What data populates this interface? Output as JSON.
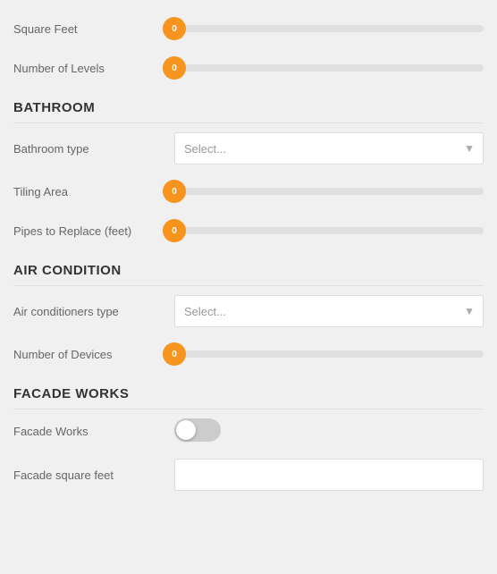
{
  "fields": {
    "square_feet": {
      "label": "Square Feet",
      "value": "0",
      "slider_pct": 0
    },
    "number_of_levels": {
      "label": "Number of Levels",
      "value": "0",
      "slider_pct": 0
    }
  },
  "sections": {
    "bathroom": {
      "heading": "BATHROOM",
      "bathroom_type": {
        "label": "Bathroom type",
        "placeholder": "Select..."
      },
      "tiling_area": {
        "label": "Tiling Area",
        "value": "0",
        "slider_pct": 0
      },
      "pipes_to_replace": {
        "label": "Pipes to Replace (feet)",
        "value": "0",
        "slider_pct": 0
      }
    },
    "air_condition": {
      "heading": "AIR CONDITION",
      "conditioners_type": {
        "label": "Air conditioners type",
        "placeholder": "Select..."
      },
      "number_of_devices": {
        "label": "Number of Devices",
        "value": "0",
        "slider_pct": 0
      }
    },
    "facade_works": {
      "heading": "FACADE WORKS",
      "facade_works": {
        "label": "Facade Works",
        "enabled": false
      },
      "facade_square_feet": {
        "label": "Facade square feet",
        "placeholder": ""
      }
    }
  },
  "colors": {
    "orange": "#f7941d",
    "track": "#e0e0e0",
    "toggle_off": "#ccc"
  }
}
